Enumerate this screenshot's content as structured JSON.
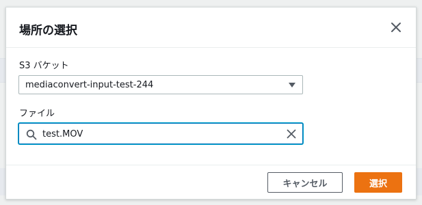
{
  "modal": {
    "title": "場所の選択"
  },
  "bucket": {
    "label": "S3 バケット",
    "selected": "mediaconvert-input-test-244"
  },
  "file": {
    "label": "ファイル",
    "value": "test.MOV"
  },
  "footer": {
    "cancel_label": "キャンセル",
    "select_label": "選択"
  },
  "colors": {
    "accent": "#ec7211",
    "focus": "#0073bb"
  },
  "icons": {
    "close": "close-icon",
    "search": "search-icon",
    "clear": "clear-icon",
    "caret": "caret-down-icon"
  }
}
